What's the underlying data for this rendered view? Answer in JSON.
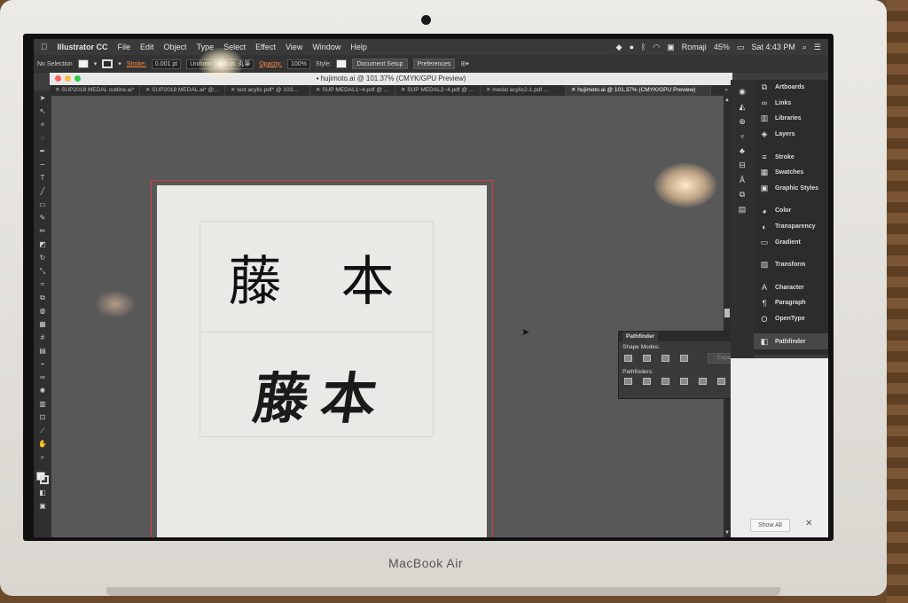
{
  "menubar": {
    "apple_icon": "apple-logo-icon",
    "app_name": "Illustrator CC",
    "menus": [
      "File",
      "Edit",
      "Object",
      "Type",
      "Select",
      "Effect",
      "View",
      "Window",
      "Help"
    ],
    "input_source": "Romaji",
    "battery": "45%",
    "clock": "Sat 4:43 PM"
  },
  "controlbar": {
    "selection": "No Selection",
    "stroke_label": "Stroke:",
    "stroke_weight": "0.001 pt",
    "stroke_profile": "Uniform",
    "brush": "5 pt. 丸筆",
    "opacity_label": "Opacity:",
    "opacity_value": "100%",
    "style_label": "Style:",
    "document_setup": "Document Setup",
    "preferences": "Preferences"
  },
  "window": {
    "title": "hujimoto.ai @ 101.37% (CMYK/GPU Preview)",
    "tabs": [
      {
        "label": "SUP2018 MEDAL outline.ai*"
      },
      {
        "label": "SUP2018 MEDAL.ai* @..."
      },
      {
        "label": "test acylic.pdf* @ 103..."
      },
      {
        "label": "SUP MEDAL1~4.pdf @ ..."
      },
      {
        "label": "SUP MEDAL2~4.pdf @ ..."
      },
      {
        "label": "medal acylic2-1.pdf ..."
      },
      {
        "label": "hujimoto.ai @ 101.37% (CMYK/GPU Preview)"
      }
    ]
  },
  "artboard": {
    "name_print": "藤 本",
    "name_brush": "藤本"
  },
  "pathfinder": {
    "title": "Pathfinder",
    "shape_modes": "Shape Modes:",
    "expand": "Expand",
    "pathfinders": "Pathfinders:"
  },
  "dock": {
    "items": [
      "Artboards",
      "Links",
      "Libraries",
      "Layers",
      "Stroke",
      "Swatches",
      "Graphic Styles",
      "Color",
      "Transparency",
      "Gradient",
      "Transform",
      "Character",
      "Paragraph",
      "OpenType",
      "Pathfinder"
    ],
    "show_all": "Show All",
    "close": "✕"
  },
  "device": {
    "brand": "MacBook Air"
  },
  "colors": {
    "artboard_border": "#d23c3c",
    "stroke_label": "#ff8a3c",
    "canvas": "#585858"
  }
}
